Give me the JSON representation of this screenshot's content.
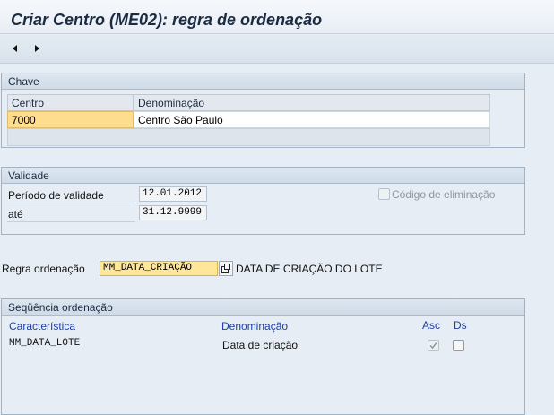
{
  "window": {
    "title": "Criar Centro (ME02): regra de ordenação"
  },
  "toolbar": {
    "back_icon": "arrow-left-icon",
    "forward_icon": "arrow-right-icon"
  },
  "chave": {
    "title": "Chave",
    "columns": [
      "Centro",
      "Denominação"
    ],
    "row": {
      "centro": "7000",
      "denominacao": "Centro São Paulo"
    }
  },
  "validade": {
    "title": "Validade",
    "periodo_label": "Período de validade",
    "periodo_value": "12.01.2012",
    "ate_label": "até",
    "ate_value": "31.12.9999",
    "codigo_eliminacao_label": "Código de eliminação",
    "codigo_eliminacao_checked": false
  },
  "regra": {
    "label": "Regra ordenação",
    "value": "MM_DATA_CRIAÇÃO",
    "description": "DATA DE CRIAÇÃO DO LOTE"
  },
  "sequencia": {
    "title": "Seqüência ordenação",
    "columns": {
      "caracteristica": "Característica",
      "denominacao": "Denominação",
      "asc": "Asc",
      "ds": "Ds"
    },
    "rows": [
      {
        "caracteristica": "MM_DATA_LOTE",
        "denominacao": "Data de criação",
        "asc": true,
        "ds": false
      }
    ]
  }
}
